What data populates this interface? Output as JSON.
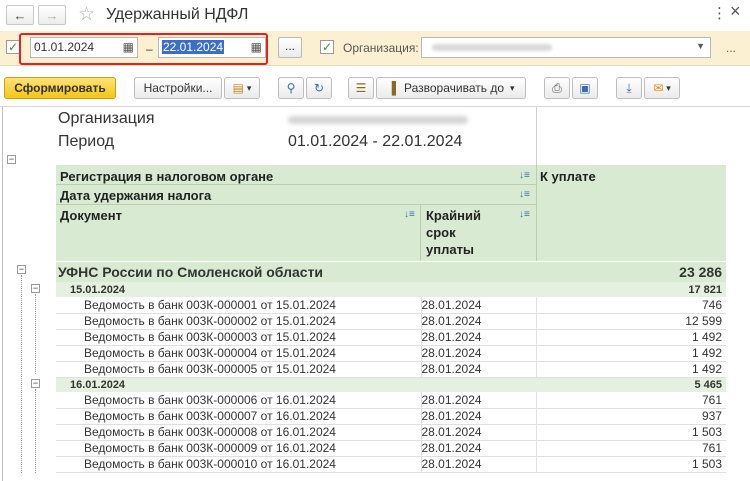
{
  "window": {
    "title": "Удержанный НДФЛ",
    "back_icon": "←",
    "forward_icon": "→",
    "star_icon": "☆",
    "more_icon": "⋮",
    "close_icon": "×"
  },
  "filters": {
    "period_checked": "✓",
    "date_from": "01.01.2024",
    "date_separator": "–",
    "date_to": "22.01.2024",
    "calendar_icon": "▦",
    "period_dots": "...",
    "org_checked": "✓",
    "org_label": "Организация:",
    "org_dropdown_icon": "▼",
    "more_dots": "..."
  },
  "toolbar": {
    "generate_label": "Сформировать",
    "settings_label": "Настройки...",
    "expand_label": "Разворачивать до",
    "dropdown_arrow": "▾"
  },
  "report": {
    "org_label": "Организация",
    "period_label": "Период",
    "period_value": "01.01.2024 - 22.01.2024",
    "headers": {
      "registration": "Регистрация в налоговом органе",
      "withholding_date": "Дата удержания налога",
      "document": "Документ",
      "deadline_line1": "Крайний",
      "deadline_line2": "срок",
      "deadline_line3": "уплаты",
      "to_pay": "К уплате"
    },
    "group": {
      "name": "УФНС России по Смоленской области",
      "total": "23 286"
    },
    "dates": [
      {
        "date": "15.01.2024",
        "total": "17 821",
        "rows": [
          {
            "doc": "Ведомость в банк 003К-000001 от 15.01.2024",
            "deadline": "28.01.2024",
            "amount": "746"
          },
          {
            "doc": "Ведомость в банк 003К-000002 от 15.01.2024",
            "deadline": "28.01.2024",
            "amount": "12 599"
          },
          {
            "doc": "Ведомость в банк 003К-000003 от 15.01.2024",
            "deadline": "28.01.2024",
            "amount": "1 492"
          },
          {
            "doc": "Ведомость в банк 003К-000004 от 15.01.2024",
            "deadline": "28.01.2024",
            "amount": "1 492"
          },
          {
            "doc": "Ведомость в банк 003К-000005 от 15.01.2024",
            "deadline": "28.01.2024",
            "amount": "1 492"
          }
        ]
      },
      {
        "date": "16.01.2024",
        "total": "5 465",
        "rows": [
          {
            "doc": "Ведомость в банк 003К-000006 от 16.01.2024",
            "deadline": "28.01.2024",
            "amount": "761"
          },
          {
            "doc": "Ведомость в банк 003К-000007 от 16.01.2024",
            "deadline": "28.01.2024",
            "amount": "937"
          },
          {
            "doc": "Ведомость в банк 003К-000008 от 16.01.2024",
            "deadline": "28.01.2024",
            "amount": "1 503"
          },
          {
            "doc": "Ведомость в банк 003К-000009 от 16.01.2024",
            "deadline": "28.01.2024",
            "amount": "761"
          },
          {
            "doc": "Ведомость в банк 003К-000010 от 16.01.2024",
            "deadline": "28.01.2024",
            "amount": "1 503"
          }
        ]
      }
    ]
  }
}
